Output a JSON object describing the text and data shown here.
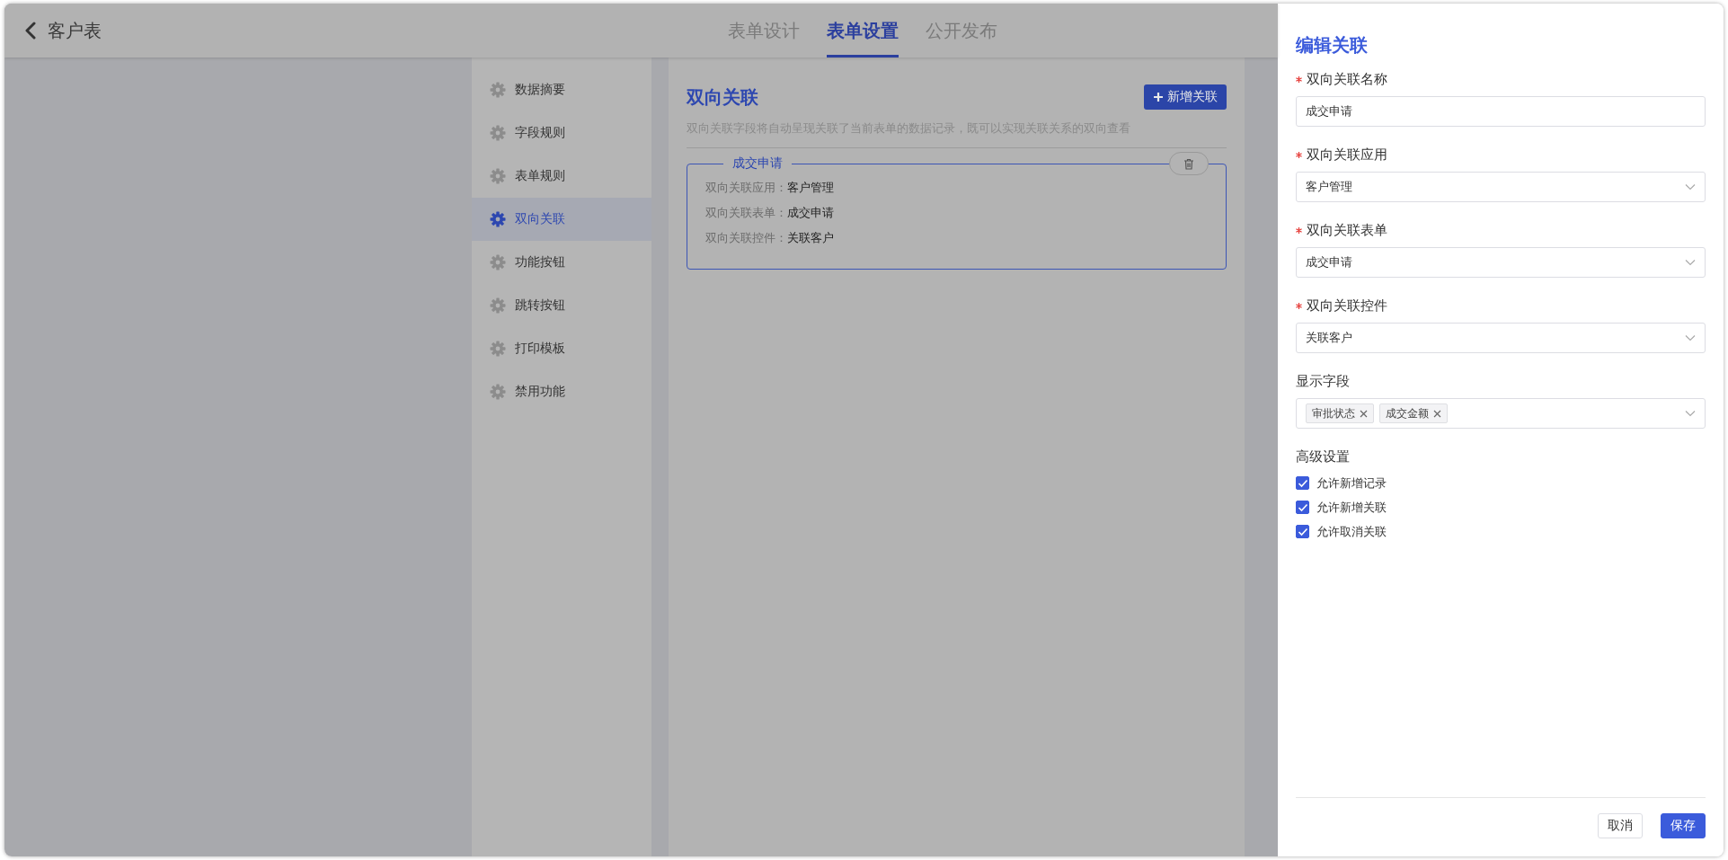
{
  "header": {
    "title": "客户表"
  },
  "tabs": [
    {
      "label": "表单设计",
      "selected": false
    },
    {
      "label": "表单设置",
      "selected": true
    },
    {
      "label": "公开发布",
      "selected": false
    }
  ],
  "sidebar": {
    "items": [
      {
        "label": "数据摘要",
        "selected": false
      },
      {
        "label": "字段规则",
        "selected": false
      },
      {
        "label": "表单规则",
        "selected": false
      },
      {
        "label": "双向关联",
        "selected": true
      },
      {
        "label": "功能按钮",
        "selected": false
      },
      {
        "label": "跳转按钮",
        "selected": false
      },
      {
        "label": "打印模板",
        "selected": false
      },
      {
        "label": "禁用功能",
        "selected": false
      }
    ]
  },
  "main": {
    "title": "双向关联",
    "add_button": "新增关联",
    "description": "双向关联字段将自动呈现关联了当前表单的数据记录，既可以实现关联关系的双向查看",
    "relations": [
      {
        "name": "成交申请",
        "fields": [
          {
            "label": "双向关联应用：",
            "value": "客户管理"
          },
          {
            "label": "双向关联表单：",
            "value": "成交申请"
          },
          {
            "label": "双向关联控件：",
            "value": "关联客户"
          }
        ]
      }
    ]
  },
  "drawer": {
    "title": "编辑关联",
    "fields": [
      {
        "kind": "input",
        "label": "双向关联名称",
        "required": true,
        "value": "成交申请"
      },
      {
        "kind": "select",
        "label": "双向关联应用",
        "required": true,
        "value": "客户管理"
      },
      {
        "kind": "select",
        "label": "双向关联表单",
        "required": true,
        "value": "成交申请"
      },
      {
        "kind": "select",
        "label": "双向关联控件",
        "required": true,
        "value": "关联客户"
      },
      {
        "kind": "tags",
        "label": "显示字段",
        "required": false,
        "tags": [
          "审批状态",
          "成交金额"
        ]
      }
    ],
    "section_title": "高级设置",
    "options": [
      {
        "label": "允许新增记录",
        "checked": true
      },
      {
        "label": "允许新增关联",
        "checked": true
      },
      {
        "label": "允许取消关联",
        "checked": true
      }
    ],
    "buttons": [
      {
        "label": "取消",
        "kind": "default"
      },
      {
        "label": "保存",
        "kind": "primary"
      }
    ]
  }
}
